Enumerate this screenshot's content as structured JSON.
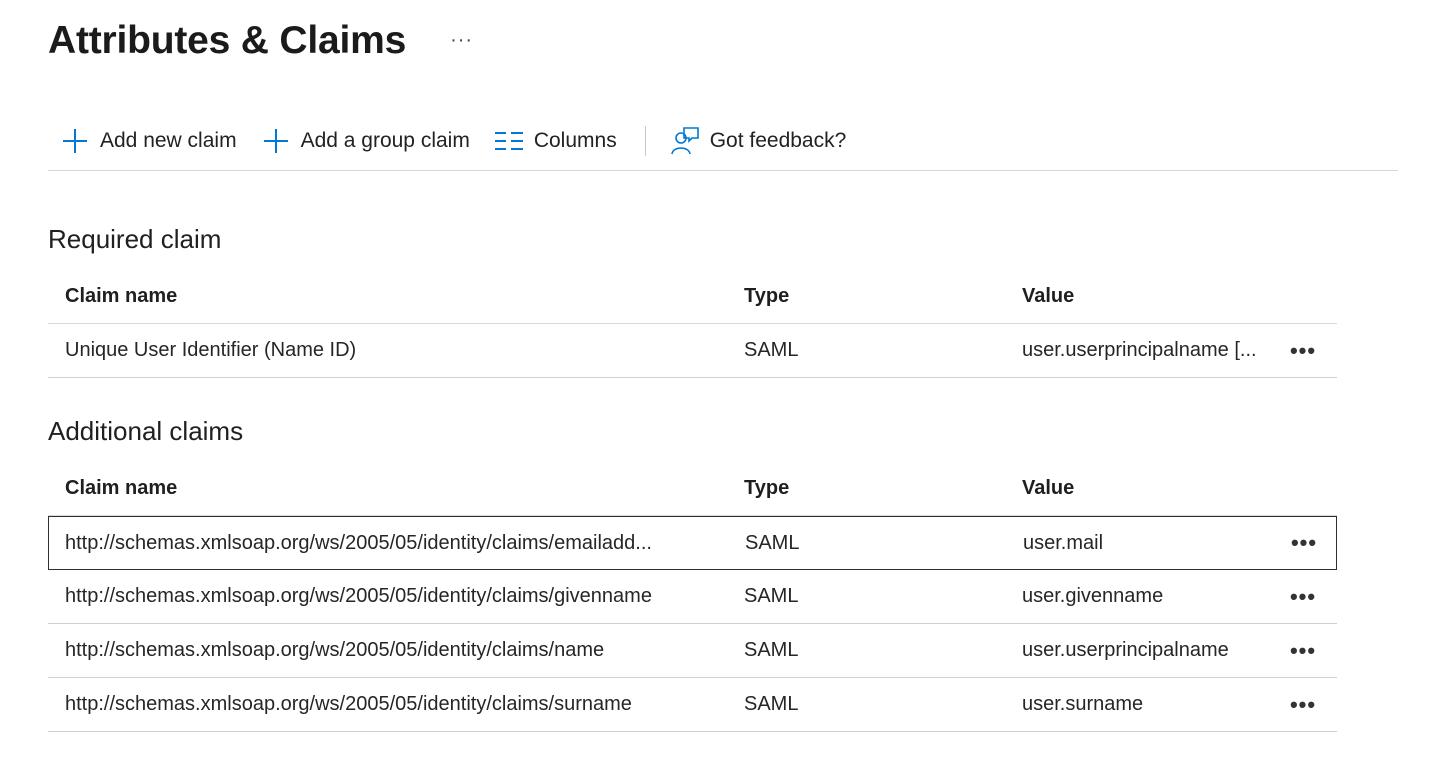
{
  "page": {
    "title": "Attributes & Claims",
    "more_label": "···"
  },
  "toolbar": {
    "add_claim": "Add new claim",
    "add_group_claim": "Add a group claim",
    "columns": "Columns",
    "feedback": "Got feedback?"
  },
  "required": {
    "title": "Required claim",
    "headers": {
      "name": "Claim name",
      "type": "Type",
      "value": "Value"
    },
    "rows": [
      {
        "name": "Unique User Identifier (Name ID)",
        "type": "SAML",
        "value": "user.userprincipalname [...",
        "more": "•••"
      }
    ]
  },
  "additional": {
    "title": "Additional claims",
    "headers": {
      "name": "Claim name",
      "type": "Type",
      "value": "Value"
    },
    "rows": [
      {
        "name": "http://schemas.xmlsoap.org/ws/2005/05/identity/claims/emailadd...",
        "type": "SAML",
        "value": "user.mail",
        "more": "•••"
      },
      {
        "name": "http://schemas.xmlsoap.org/ws/2005/05/identity/claims/givenname",
        "type": "SAML",
        "value": "user.givenname",
        "more": "•••"
      },
      {
        "name": "http://schemas.xmlsoap.org/ws/2005/05/identity/claims/name",
        "type": "SAML",
        "value": "user.userprincipalname",
        "more": "•••"
      },
      {
        "name": "http://schemas.xmlsoap.org/ws/2005/05/identity/claims/surname",
        "type": "SAML",
        "value": "user.surname",
        "more": "•••"
      }
    ]
  },
  "colors": {
    "accent": "#0078d4",
    "text": "#1f1f1f",
    "divider": "#d6d6d6"
  },
  "icons": {
    "add": "plus-icon",
    "columns": "columns-icon",
    "feedback": "feedback-icon"
  }
}
